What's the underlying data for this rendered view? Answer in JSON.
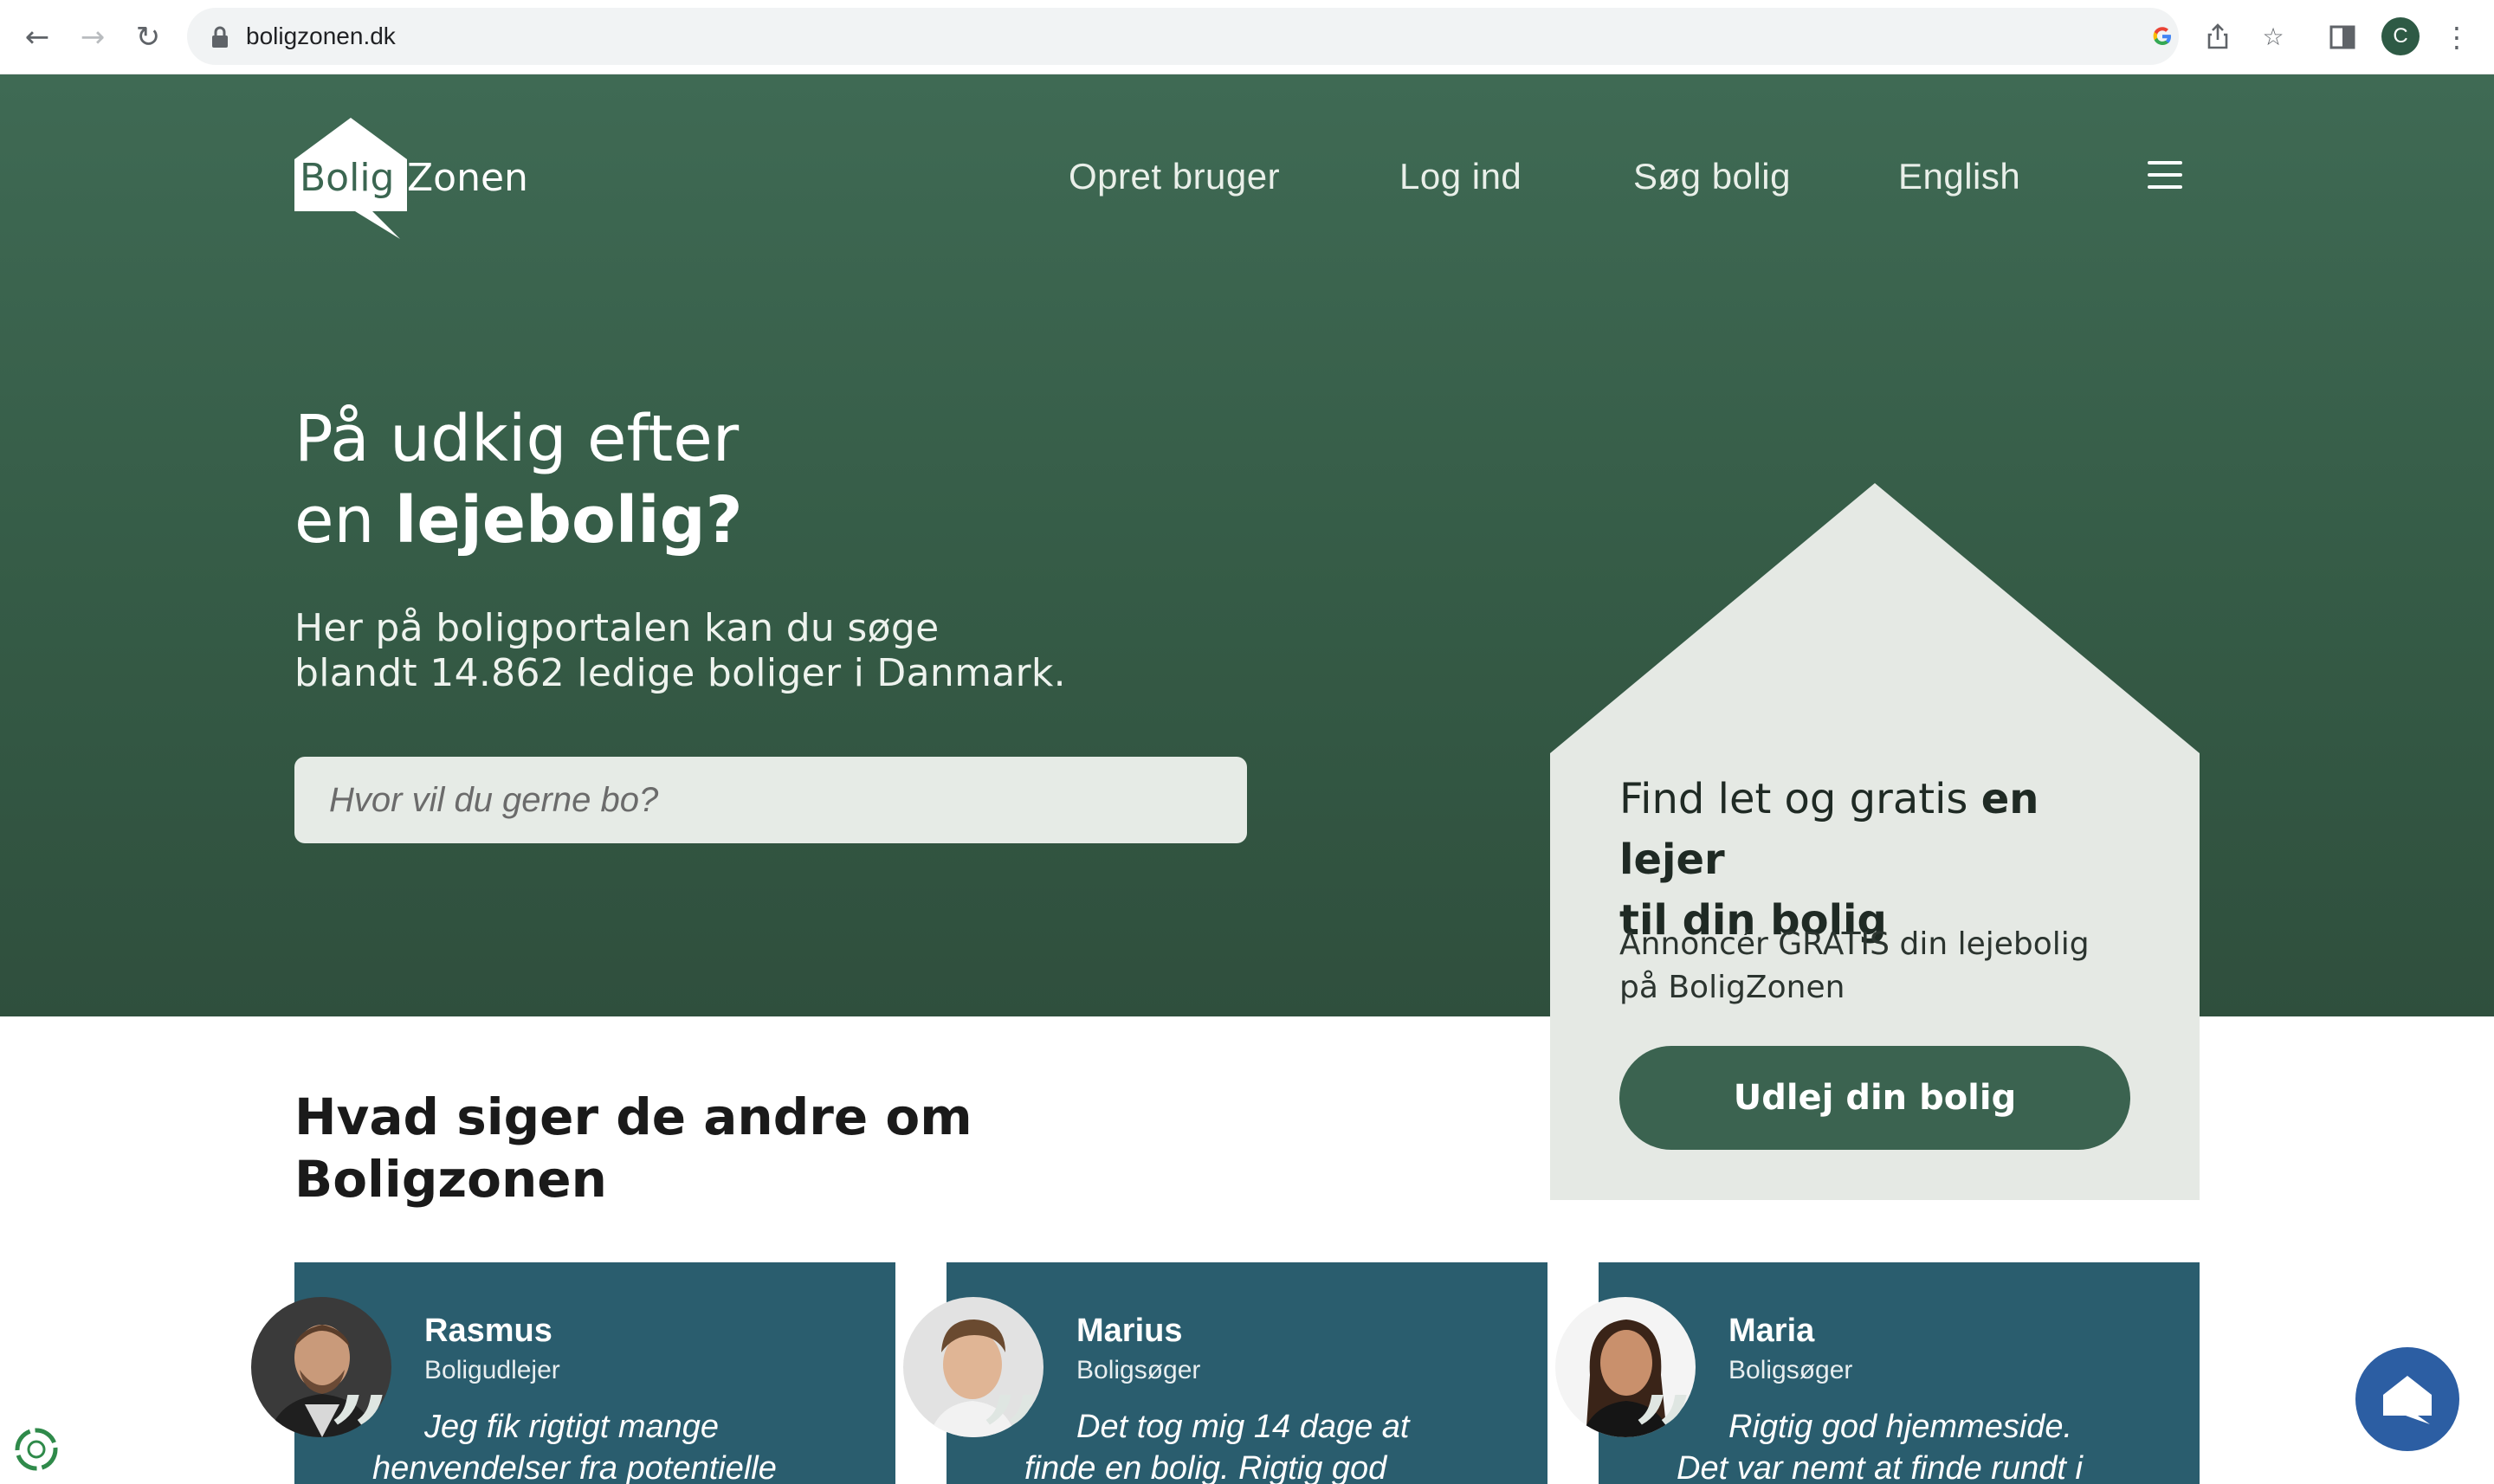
{
  "browser": {
    "url": "boligzonen.dk",
    "profile_initial": "C",
    "icons": [
      "back-icon",
      "forward-icon",
      "reload-icon",
      "lock-icon",
      "google-icon",
      "share-icon",
      "star-icon",
      "side-panel-icon",
      "more-icon"
    ]
  },
  "header": {
    "logo_part1": "Bolig",
    "logo_part2": "Zonen",
    "nav": [
      "Opret bruger",
      "Log ind",
      "Søg bolig",
      "English"
    ],
    "menu_icon": "hamburger-icon"
  },
  "hero": {
    "title_line1": "På udkig efter",
    "title_line2_prefix": "en ",
    "title_line2_bold": "lejebolig?",
    "subtitle_line1": "Her på boligportalen kan du søge",
    "subtitle_line2": "blandt 14.862 ledige boliger i Danmark.",
    "search_placeholder": "Hvor vil du gerne bo?"
  },
  "landlord_card": {
    "title_normal": "Find let og gratis ",
    "title_bold_1": "en lejer",
    "title_bold_2": "til din bolig",
    "body_line1": "Annoncér GRATIS din lejebolig",
    "body_line2": "på BoligZonen",
    "button": "Udlej din bolig"
  },
  "testimonials": {
    "heading_line1": "Hvad siger de andre om",
    "heading_line2": "Boligzonen",
    "quote_mark": "”",
    "items": [
      {
        "name": "Rasmus",
        "role": "Boligudlejer",
        "quote_line1": "Jeg fik rigtigt mange",
        "quote_line2": "henvendelser fra potentielle"
      },
      {
        "name": "Marius",
        "role": "Boligsøger",
        "quote_line1": "Det tog mig 14 dage at",
        "quote_line2": "finde en bolig. Rigtig god"
      },
      {
        "name": "Maria",
        "role": "Boligsøger",
        "quote_line1": "Rigtig god hjemmeside.",
        "quote_line2": "Det var nemt at finde rundt i"
      }
    ]
  },
  "colors": {
    "hero_green": "#3f6a54",
    "card_bg": "#e5e9e4",
    "button_green": "#3b6350",
    "testimonial_bg": "#2a5d6e",
    "chat_blue": "#2c5ea3"
  },
  "widgets": {
    "chat_icon": "chat-house-icon",
    "cookie_icon": "cookie-settings-icon"
  }
}
